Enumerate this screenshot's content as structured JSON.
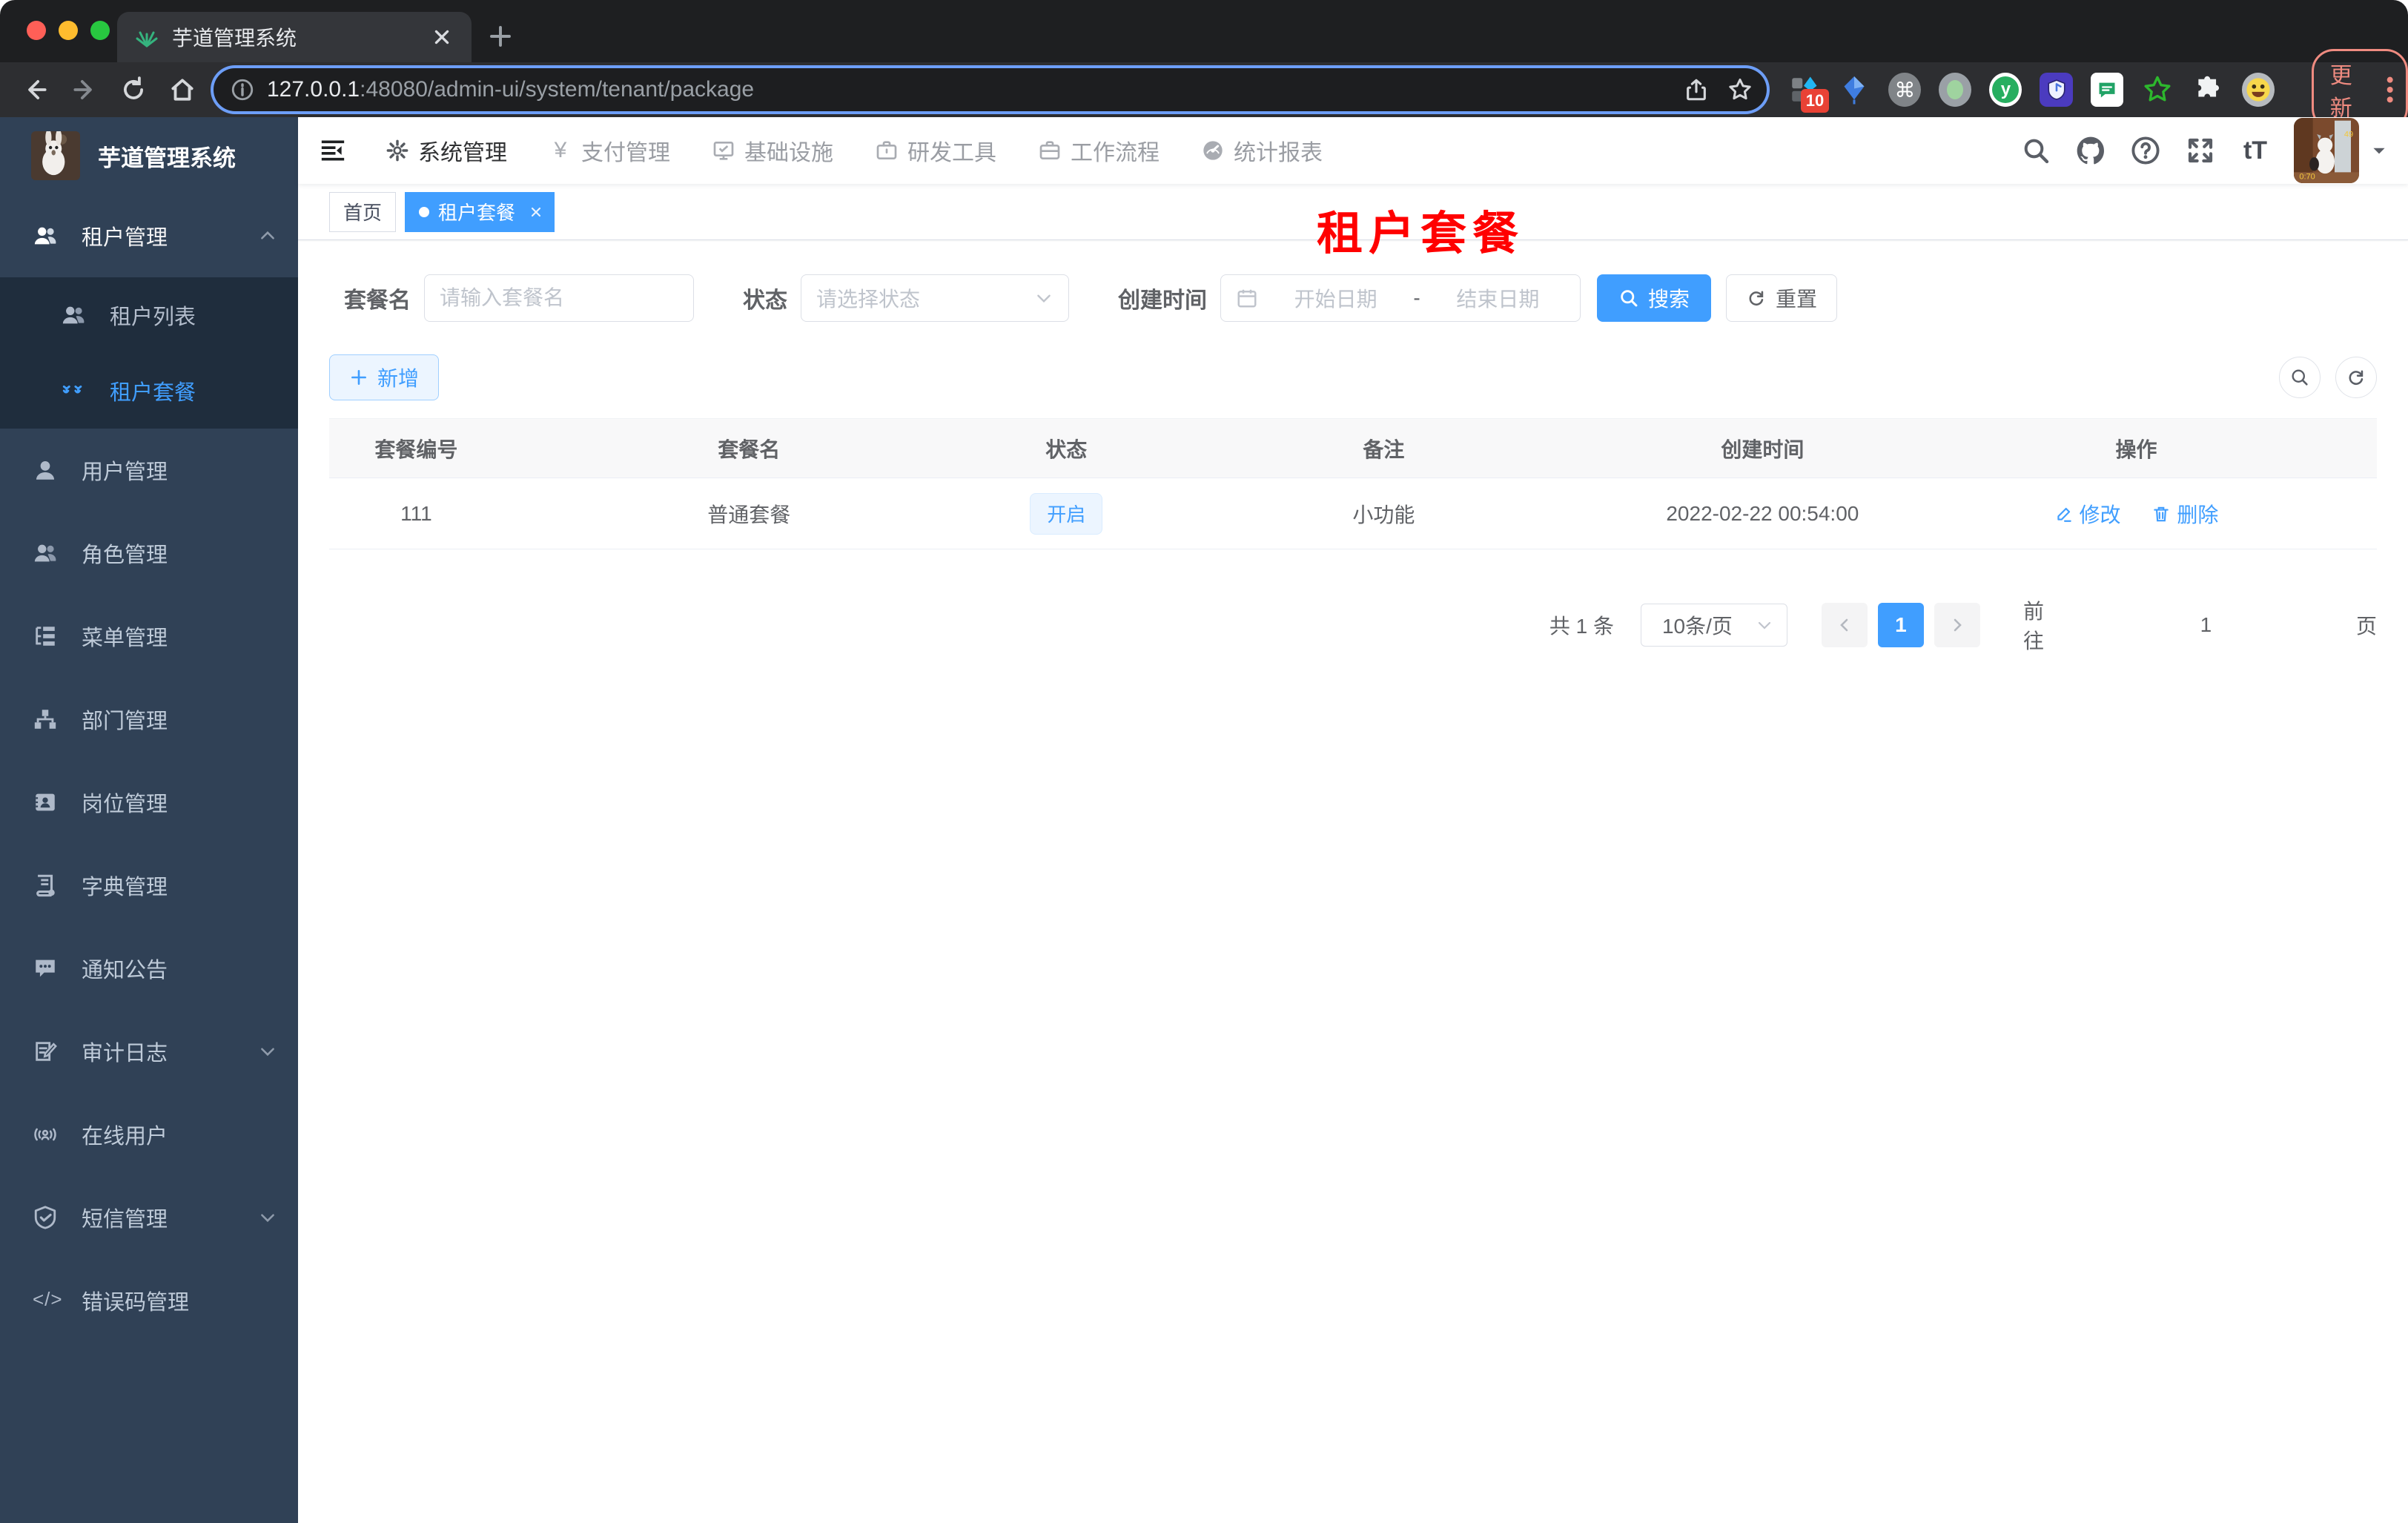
{
  "colors": {
    "accent": "#409eff",
    "red_title": "#ff0000",
    "traffic_close": "#ff5f57",
    "traffic_min": "#febc2e",
    "traffic_max": "#28c840",
    "ext_badge_bg": "#e94235",
    "update": "#ef8b80",
    "sidebar_bg": "#304156",
    "submenu_bg": "#1f2d3d"
  },
  "browser": {
    "tab_title": "芋道管理系统",
    "url_host": "127.0.0.1",
    "url_rest": ":48080/admin-ui/system/tenant/package",
    "ext_badge": "10",
    "update_label": "更新"
  },
  "icons": {
    "yen": "¥",
    "help": "?",
    "command": "⌘",
    "code": "</>",
    "font_size": "tT"
  },
  "topnav": {
    "items": [
      {
        "label": "系统管理"
      },
      {
        "label": "支付管理"
      },
      {
        "label": "基础设施"
      },
      {
        "label": "研发工具"
      },
      {
        "label": "工作流程"
      },
      {
        "label": "统计报表"
      }
    ]
  },
  "sidebar": {
    "title": "芋道管理系统",
    "items": [
      {
        "label": "租户管理"
      },
      {
        "label": "租户列表"
      },
      {
        "label": "租户套餐"
      },
      {
        "label": "用户管理"
      },
      {
        "label": "角色管理"
      },
      {
        "label": "菜单管理"
      },
      {
        "label": "部门管理"
      },
      {
        "label": "岗位管理"
      },
      {
        "label": "字典管理"
      },
      {
        "label": "通知公告"
      },
      {
        "label": "审计日志"
      },
      {
        "label": "在线用户"
      },
      {
        "label": "短信管理"
      },
      {
        "label": "错误码管理"
      }
    ]
  },
  "tags": {
    "items": [
      {
        "label": "首页"
      },
      {
        "label": "租户套餐"
      }
    ]
  },
  "page_title": "租户套餐",
  "filters": {
    "name_label": "套餐名",
    "name_placeholder": "请输入套餐名",
    "status_label": "状态",
    "status_placeholder": "请选择状态",
    "date_label": "创建时间",
    "date_start": "开始日期",
    "date_sep": "-",
    "date_end": "结束日期",
    "search_label": "搜索",
    "reset_label": "重置"
  },
  "toolbar": {
    "add_label": "新增"
  },
  "table": {
    "headers": [
      "套餐编号",
      "套餐名",
      "状态",
      "备注",
      "创建时间",
      "操作"
    ],
    "rows": [
      {
        "id": "111",
        "name": "普通套餐",
        "status": "开启",
        "remark": "小功能",
        "created": "2022-02-22 00:54:00",
        "edit": "修改",
        "delete": "删除"
      }
    ]
  },
  "pagination": {
    "total": "共 1 条",
    "page_size": "10条/页",
    "page": "1",
    "goto_label": "前往",
    "goto_value": "1",
    "unit_label": "页"
  }
}
